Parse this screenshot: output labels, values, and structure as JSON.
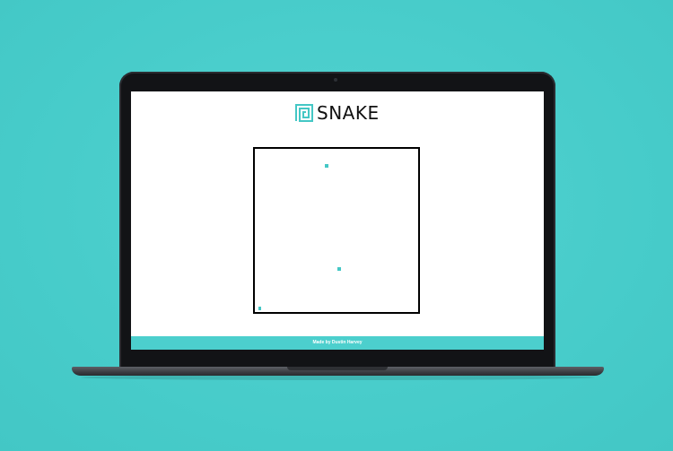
{
  "app": {
    "title": "SNAKE",
    "logo_icon": "square-spiral-icon",
    "accent_color": "#44c7c5"
  },
  "game": {
    "board_border_color": "#000000"
  },
  "footer": {
    "credit": "Made by Dustin Harvey"
  },
  "background": {
    "color": "#4dd0cf"
  }
}
